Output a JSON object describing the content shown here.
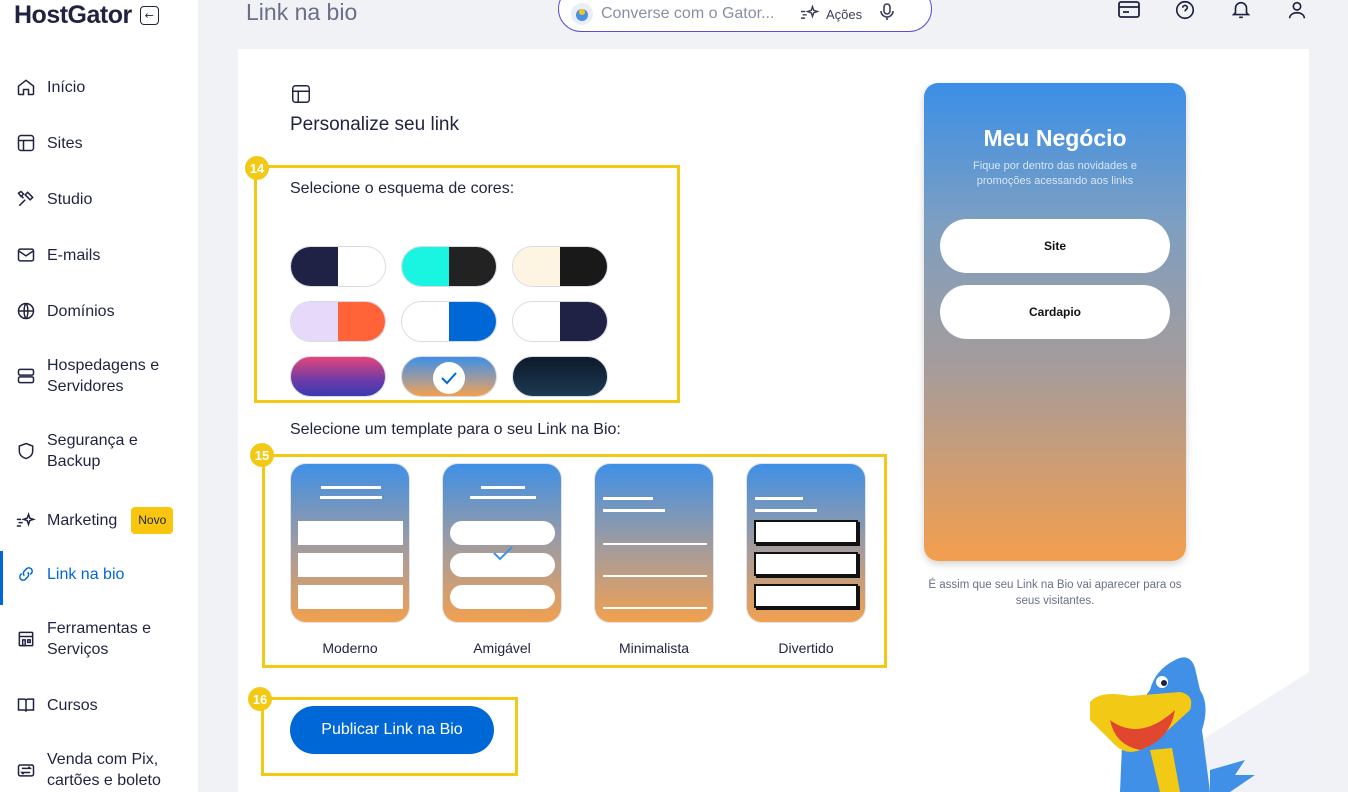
{
  "brand": {
    "logo_text": "HostGator",
    "collapse_icon": "arrow-left-icon"
  },
  "sidebar": {
    "items": [
      {
        "label": "Início",
        "icon": "home-icon"
      },
      {
        "label": "Sites",
        "icon": "layout-icon"
      },
      {
        "label": "Studio",
        "icon": "tools-icon"
      },
      {
        "label": "E-mails",
        "icon": "mail-icon"
      },
      {
        "label": "Domínios",
        "icon": "globe-icon"
      },
      {
        "label": "Hospedagens e Servidores",
        "icon": "server-icon"
      },
      {
        "label": "Segurança e Backup",
        "icon": "shield-icon"
      },
      {
        "label": "Marketing",
        "icon": "sparkle-icon",
        "badge": "Novo"
      },
      {
        "label": "Link na bio",
        "icon": "link-icon",
        "active": true
      },
      {
        "label": "Ferramentas e Serviços",
        "icon": "store-icon"
      },
      {
        "label": "Cursos",
        "icon": "book-icon"
      },
      {
        "label": "Venda com Pix, cartões e boleto",
        "icon": "exchange-icon"
      }
    ]
  },
  "header": {
    "page_title": "Link na bio",
    "chat": {
      "placeholder": "Converse com o Gator...",
      "actions_label": "Ações"
    },
    "icons": [
      "credit-card-icon",
      "help-icon",
      "bell-icon",
      "user-icon"
    ]
  },
  "content": {
    "section_title": "Personalize seu link",
    "color_scheme_label": "Selecione o esquema de cores:",
    "template_label": "Selecione um template para o seu Link na Bio:",
    "color_schemes": [
      {
        "left": "#1f2245",
        "right": "#ffffff"
      },
      {
        "left": "#19f5e1",
        "right": "#222222"
      },
      {
        "left": "#fdf5e1",
        "right": "#191919"
      },
      {
        "left": "#e6d9f9",
        "right": "#ff6337"
      },
      {
        "left": "#ffffff",
        "right": "#0068d6"
      },
      {
        "left": "#ffffff",
        "right": "#1f2245"
      },
      {
        "gradient": [
          "#e3457a",
          "#6c3ba8",
          "#3a3ab0"
        ]
      },
      {
        "gradient": [
          "#3f8fe6",
          "#a69c9a",
          "#f2a04f"
        ],
        "selected": true
      },
      {
        "gradient": [
          "#0d1a2a",
          "#1c3a52"
        ]
      }
    ],
    "templates": [
      {
        "name": "Moderno"
      },
      {
        "name": "Amigável",
        "selected": true
      },
      {
        "name": "Minimalista"
      },
      {
        "name": "Divertido"
      }
    ],
    "publish_button": "Publicar Link na Bio",
    "markers": [
      "14",
      "15",
      "16"
    ]
  },
  "preview": {
    "title": "Meu Negócio",
    "subtitle": "Fique por dentro das novidades e promoções acessando aos links",
    "links": [
      "Site",
      "Cardapio"
    ],
    "caption": "É assim que seu Link na Bio vai aparecer para os seus visitantes."
  },
  "colors": {
    "accent": "#0068d6",
    "highlight": "#f2ca16",
    "text": "#1f2340"
  }
}
